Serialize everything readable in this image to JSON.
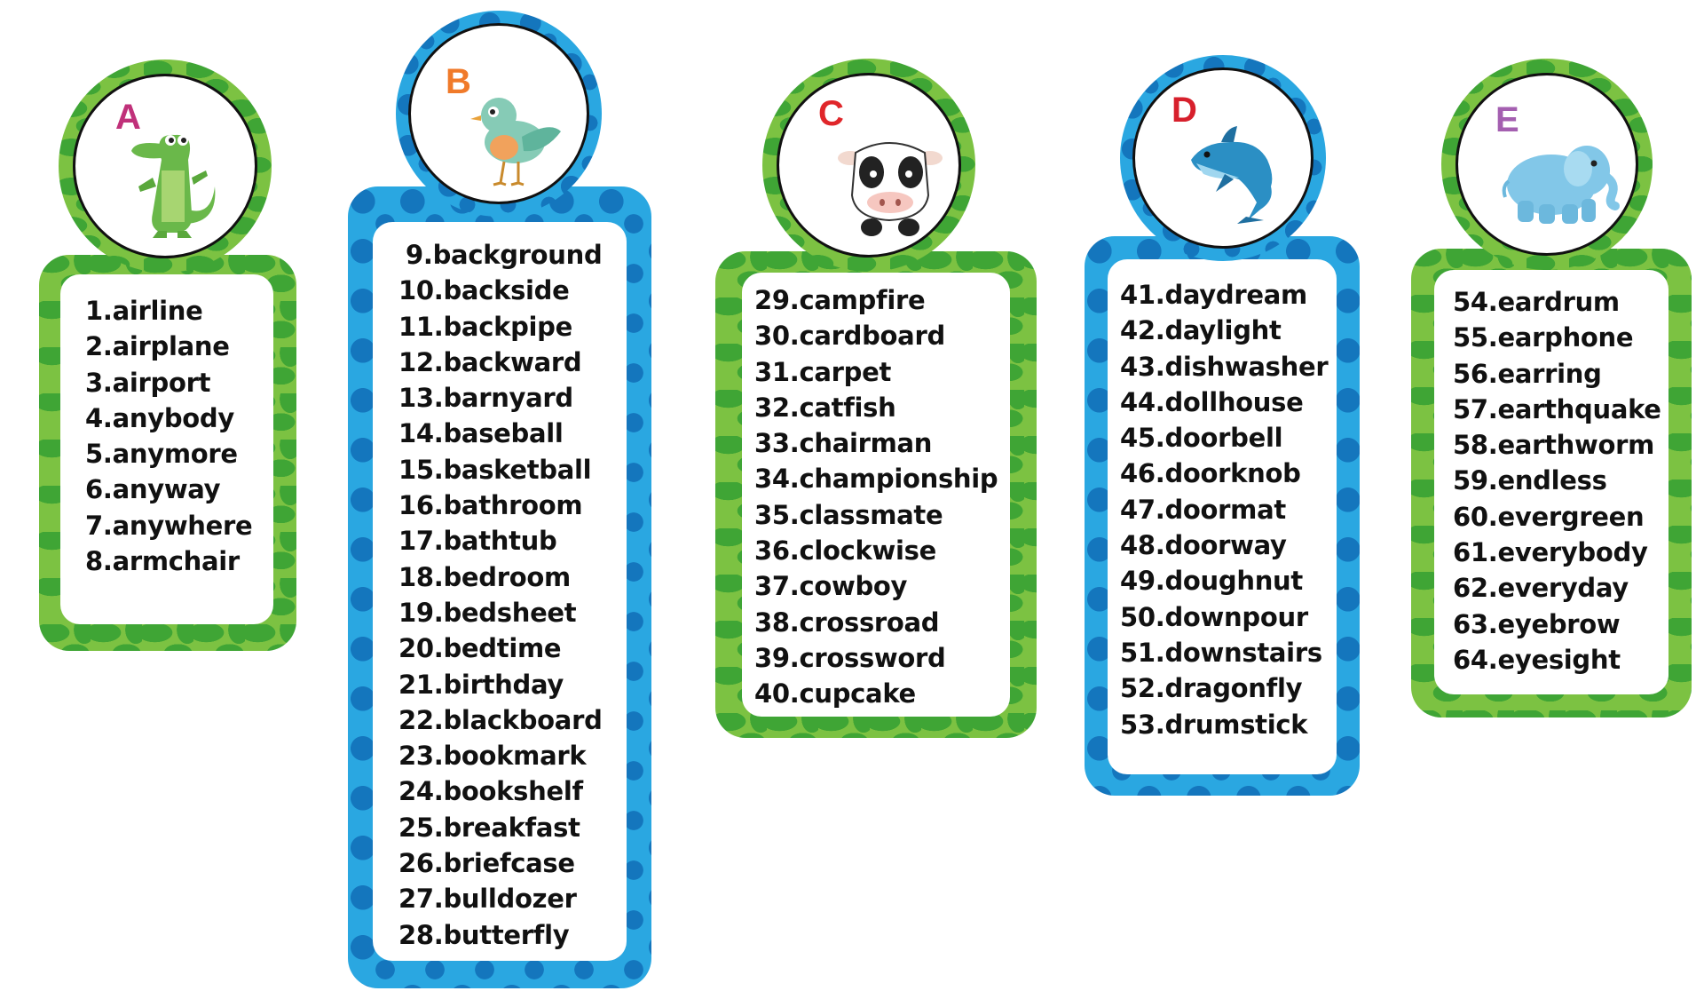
{
  "colors": {
    "green_frame": "#7cc242",
    "blue_frame": "#2aa7e1",
    "letter_A": "#c0317a",
    "letter_B": "#f07a2a",
    "letter_C": "#e0262a",
    "letter_D": "#d7202c",
    "letter_E": "#a45fb0"
  },
  "cards": [
    {
      "letter": "A",
      "icon": "crocodile-icon",
      "words": [
        "1.airline",
        "2.airplane",
        "3.airport",
        "4.anybody",
        "5.anymore",
        "6.anyway",
        "7.anywhere",
        "8.armchair"
      ]
    },
    {
      "letter": "B",
      "icon": "bird-icon",
      "words": [
        "9.background",
        "10.backside",
        "11.backpipe",
        "12.backward",
        "13.barnyard",
        "14.baseball",
        "15.basketball",
        "16.bathroom",
        "17.bathtub",
        "18.bedroom",
        "19.bedsheet",
        "20.bedtime",
        "21.birthday",
        "22.blackboard",
        "23.bookmark",
        "24.bookshelf",
        "25.breakfast",
        "26.briefcase",
        "27.bulldozer",
        "28.butterfly"
      ]
    },
    {
      "letter": "C",
      "icon": "cow-icon",
      "words": [
        "29.campfire",
        "30.cardboard",
        "31.carpet",
        "32.catfish",
        "33.chairman",
        "34.championship",
        "35.classmate",
        "36.clockwise",
        "37.cowboy",
        "38.crossroad",
        "39.crossword",
        "40.cupcake"
      ]
    },
    {
      "letter": "D",
      "icon": "dolphin-icon",
      "words": [
        "41.daydream",
        "42.daylight",
        "43.dishwasher",
        "44.dollhouse",
        "45.doorbell",
        "46.doorknob",
        "47.doormat",
        "48.doorway",
        "49.doughnut",
        "50.downpour",
        "51.downstairs",
        "52.dragonfly",
        "53.drumstick"
      ]
    },
    {
      "letter": "E",
      "icon": "elephant-icon",
      "words": [
        "54.eardrum",
        "55.earphone",
        "56.earring",
        "57.earthquake",
        "58.earthworm",
        "59.endless",
        "60.evergreen",
        "61.everybody",
        "62.everyday",
        "63.eyebrow",
        "64.eyesight"
      ]
    }
  ]
}
